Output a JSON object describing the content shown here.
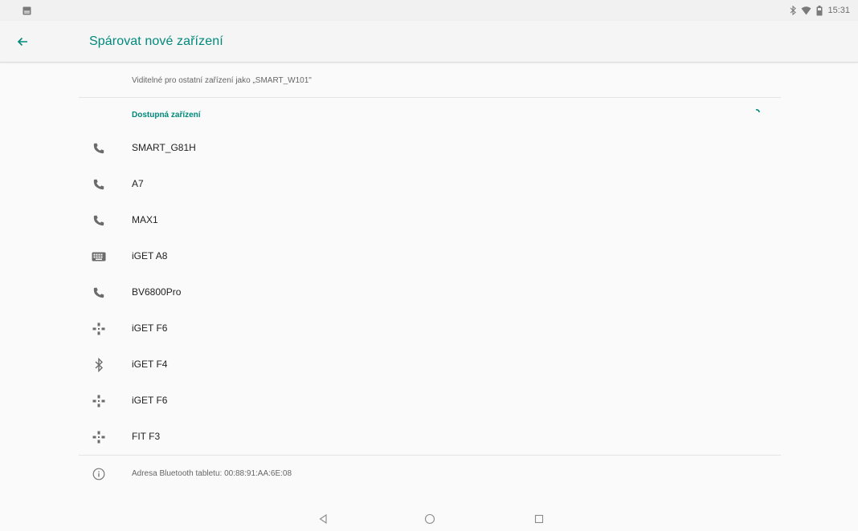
{
  "status_bar": {
    "time": "15:31",
    "icons": [
      "notification-icon",
      "bluetooth-icon",
      "wifi-icon",
      "battery-icon"
    ]
  },
  "app_bar": {
    "title": "Spárovat nové zařízení",
    "accent_color": "#00897b"
  },
  "visible_as": "Viditelné pro ostatní zařízení jako „SMART_W101\"",
  "section": {
    "title": "Dostupná zařízení"
  },
  "devices": [
    {
      "name": "SMART_G81H",
      "icon": "phone-icon"
    },
    {
      "name": "A7",
      "icon": "phone-icon"
    },
    {
      "name": "MAX1",
      "icon": "phone-icon"
    },
    {
      "name": "iGET A8",
      "icon": "keyboard-icon"
    },
    {
      "name": "BV6800Pro",
      "icon": "phone-icon"
    },
    {
      "name": "iGET F6",
      "icon": "gamepad-icon"
    },
    {
      "name": "iGET F4",
      "icon": "bluetooth-icon"
    },
    {
      "name": "iGET F6",
      "icon": "gamepad-icon"
    },
    {
      "name": "FIT F3",
      "icon": "gamepad-icon"
    }
  ],
  "footer_info": "Adresa Bluetooth tabletu: 00:88:91:AA:6E:08",
  "nav_bar": {
    "buttons": [
      "back-triangle-icon",
      "home-circle-icon",
      "recents-square-icon"
    ]
  }
}
